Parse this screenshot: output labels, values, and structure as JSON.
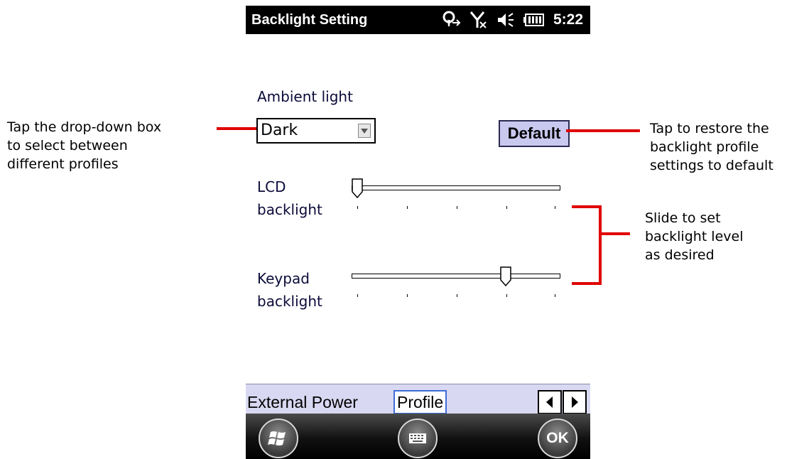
{
  "statusbar": {
    "title": "Backlight Setting",
    "time": "5:22"
  },
  "content": {
    "ambient_label": "Ambient light",
    "ambient_value": "Dark",
    "default_label": "Default",
    "lcd_label_line1": "LCD",
    "lcd_label_line2": "backlight",
    "keypad_label_line1": "Keypad",
    "keypad_label_line2": "backlight",
    "lcd_slider_level": 0,
    "keypad_slider_level": 0.75
  },
  "tabs": {
    "external_power": "External Power",
    "profile": "Profile"
  },
  "softkeys": {
    "ok": "OK"
  },
  "annotations": {
    "dropdown_line1": "Tap the drop-down box",
    "dropdown_line2": "to select between",
    "dropdown_line3": "different profiles",
    "default_line1": "Tap to restore the",
    "default_line2": "backlight profile",
    "default_line3": "settings to default",
    "slider_line1": "Slide to set",
    "slider_line2": "backlight level",
    "slider_line3": "as desired"
  },
  "colors": {
    "accent_red": "#e00000",
    "tab_bg": "#d9d8f2",
    "default_btn_bg": "#c9c8ee"
  }
}
